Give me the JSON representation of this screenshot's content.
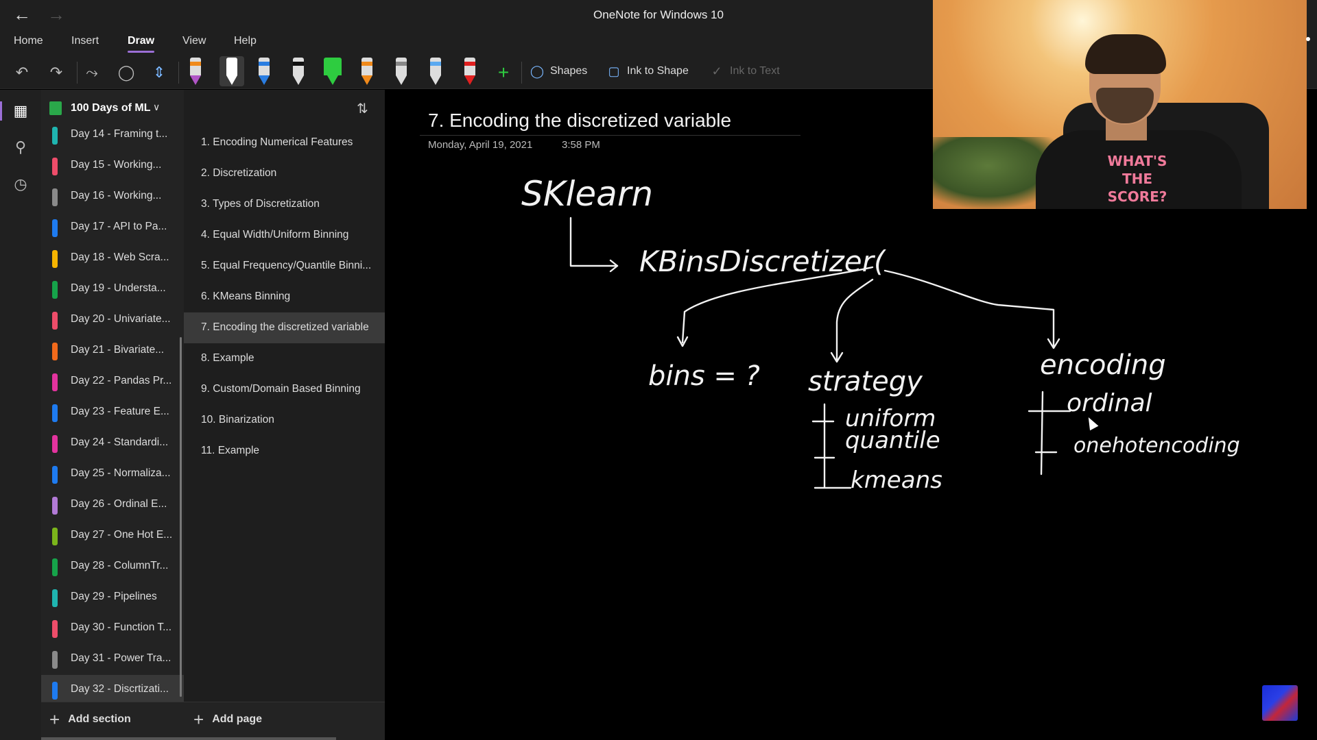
{
  "window": {
    "title": "OneNote for Windows 10"
  },
  "menu": {
    "tabs": [
      "Home",
      "Insert",
      "Draw",
      "View",
      "Help"
    ],
    "active": "Draw"
  },
  "toolbar": {
    "shapes_label": "Shapes",
    "ink_to_shape_label": "Ink to Shape",
    "ink_to_text_label": "Ink to Text"
  },
  "notebook": {
    "title": "100 Days of ML"
  },
  "sections": [
    {
      "label": "Day 14 - Framing t...",
      "color": "#1fb5b0"
    },
    {
      "label": "Day 15 - Working...",
      "color": "#ee4d6a"
    },
    {
      "label": "Day 16 - Working...",
      "color": "#8a8a8a"
    },
    {
      "label": "Day 17 - API to Pa...",
      "color": "#1e7bf0"
    },
    {
      "label": "Day 18 - Web Scra...",
      "color": "#f6b400"
    },
    {
      "label": "Day 19 - Understa...",
      "color": "#16a34a"
    },
    {
      "label": "Day 20 - Univariate...",
      "color": "#ee4d6a"
    },
    {
      "label": "Day 21 - Bivariate...",
      "color": "#f26a1b"
    },
    {
      "label": "Day 22 - Pandas Pr...",
      "color": "#e3339e"
    },
    {
      "label": "Day 23 - Feature E...",
      "color": "#1e7bf0"
    },
    {
      "label": "Day 24 - Standardi...",
      "color": "#e3339e"
    },
    {
      "label": "Day 25 - Normaliza...",
      "color": "#1e7bf0"
    },
    {
      "label": "Day 26 - Ordinal E...",
      "color": "#b27ad6"
    },
    {
      "label": "Day 27 - One Hot E...",
      "color": "#7bb51b"
    },
    {
      "label": "Day 28 - ColumnTr...",
      "color": "#16a34a"
    },
    {
      "label": "Day 29 - Pipelines",
      "color": "#1fb5b0"
    },
    {
      "label": "Day 30 - Function T...",
      "color": "#ee4d6a"
    },
    {
      "label": "Day 31 - Power Tra...",
      "color": "#8a8a8a"
    },
    {
      "label": "Day 32 - Discrtizati...",
      "color": "#1e7bf0"
    }
  ],
  "pages": [
    "1. Encoding Numerical Features",
    "2. Discretization",
    "3. Types of Discretization",
    "4. Equal Width/Uniform Binning",
    "5. Equal Frequency/Quantile Binni...",
    "6. KMeans Binning",
    "7. Encoding the discretized variable",
    "8. Example",
    "9. Custom/Domain Based Binning",
    "10. Binarization",
    "11. Example"
  ],
  "footer": {
    "add_section": "Add section",
    "add_page": "Add page"
  },
  "note": {
    "title": "7. Encoding the discretized variable",
    "date": "Monday, April 19, 2021",
    "time": "3:58 PM",
    "ink": {
      "root": "SKlearn",
      "call": "KBinsDiscretizer(",
      "bins": "bins = ?",
      "strategy": "strategy",
      "strategy_options": [
        "uniform",
        "quantile",
        "kmeans"
      ],
      "encoding": "encoding",
      "encoding_options": [
        "ordinal",
        "onehotencoding"
      ]
    }
  },
  "webcam": {
    "shirt_text": "WHAT'S THE SCORE?"
  }
}
